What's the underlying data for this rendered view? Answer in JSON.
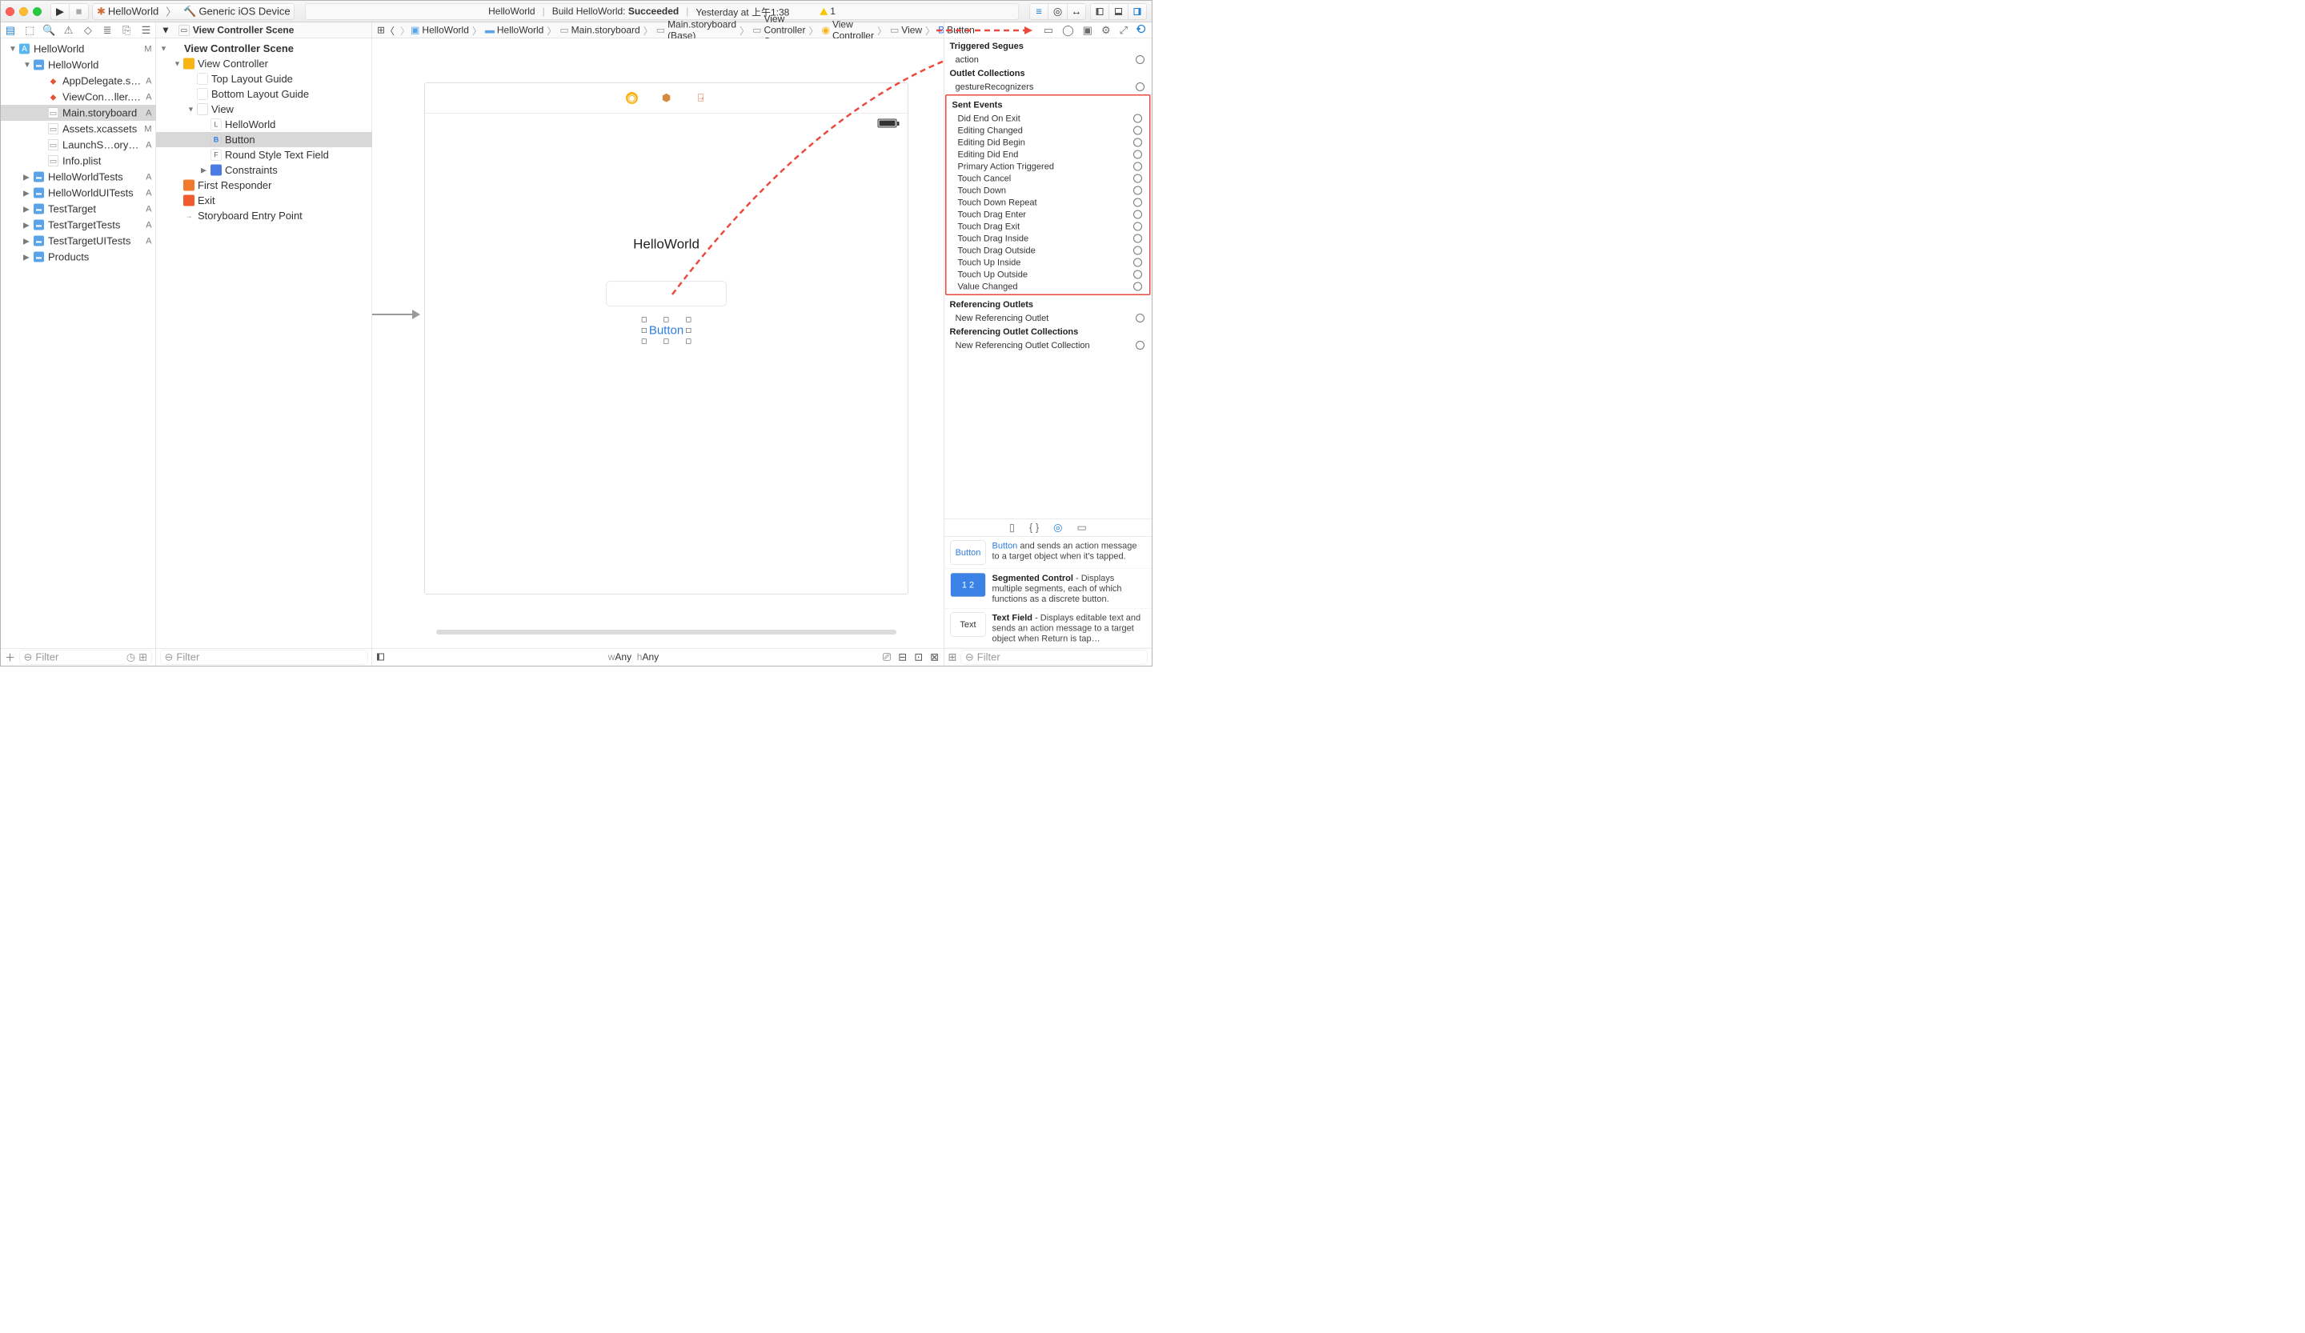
{
  "toolbar": {
    "scheme_app": "HelloWorld",
    "scheme_dest": "Generic iOS Device",
    "activity_prefix": "HelloWorld",
    "activity_mid": "Build HelloWorld:",
    "activity_status": "Succeeded",
    "activity_time": "Yesterday at 上午1:38",
    "warn_count": "1"
  },
  "nav": {
    "filter_placeholder": "Filter",
    "items": [
      {
        "ind": 0,
        "icon": "appicon",
        "disc": "▼",
        "name": "HelloWorld",
        "badge": "M"
      },
      {
        "ind": 1,
        "icon": "folder",
        "disc": "▼",
        "name": "HelloWorld",
        "badge": ""
      },
      {
        "ind": 2,
        "icon": "swift",
        "disc": "",
        "name": "AppDelegate.swift",
        "badge": "A"
      },
      {
        "ind": 2,
        "icon": "swift",
        "disc": "",
        "name": "ViewCon…ller.swift",
        "badge": "A"
      },
      {
        "ind": 2,
        "icon": "sb",
        "disc": "",
        "name": "Main.storyboard",
        "badge": "A",
        "sel": true
      },
      {
        "ind": 2,
        "icon": "sb",
        "disc": "",
        "name": "Assets.xcassets",
        "badge": "M"
      },
      {
        "ind": 2,
        "icon": "sb",
        "disc": "",
        "name": "LaunchS…oryboard",
        "badge": "A"
      },
      {
        "ind": 2,
        "icon": "sb",
        "disc": "",
        "name": "Info.plist",
        "badge": ""
      },
      {
        "ind": 1,
        "icon": "folder",
        "disc": "▶",
        "name": "HelloWorldTests",
        "badge": "A"
      },
      {
        "ind": 1,
        "icon": "folder",
        "disc": "▶",
        "name": "HelloWorldUITests",
        "badge": "A"
      },
      {
        "ind": 1,
        "icon": "folder",
        "disc": "▶",
        "name": "TestTarget",
        "badge": "A"
      },
      {
        "ind": 1,
        "icon": "folder",
        "disc": "▶",
        "name": "TestTargetTests",
        "badge": "A"
      },
      {
        "ind": 1,
        "icon": "folder",
        "disc": "▶",
        "name": "TestTargetUITests",
        "badge": "A"
      },
      {
        "ind": 1,
        "icon": "folder",
        "disc": "▶",
        "name": "Products",
        "badge": ""
      }
    ]
  },
  "outline": {
    "title": "View Controller Scene",
    "filter_placeholder": "Filter",
    "items": [
      {
        "ind": 0,
        "disc": "▼",
        "icon": "",
        "name": "View Controller Scene",
        "bold": true
      },
      {
        "ind": 1,
        "disc": "▼",
        "icon": "vcicon",
        "name": "View Controller"
      },
      {
        "ind": 2,
        "disc": "",
        "icon": "guideicon",
        "name": "Top Layout Guide"
      },
      {
        "ind": 2,
        "disc": "",
        "icon": "guideicon",
        "name": "Bottom Layout Guide"
      },
      {
        "ind": 2,
        "disc": "▼",
        "icon": "viewicon",
        "name": "View"
      },
      {
        "ind": 3,
        "disc": "",
        "icon": "licon",
        "glyph": "L",
        "name": "HelloWorld"
      },
      {
        "ind": 3,
        "disc": "",
        "icon": "bicon",
        "glyph": "B",
        "name": "Button",
        "sel": true
      },
      {
        "ind": 3,
        "disc": "",
        "icon": "licon",
        "glyph": "F",
        "name": "Round Style Text Field"
      },
      {
        "ind": 3,
        "disc": "▶",
        "icon": "cicon",
        "name": "Constraints"
      },
      {
        "ind": 1,
        "disc": "",
        "icon": "fricon",
        "name": "First Responder"
      },
      {
        "ind": 1,
        "disc": "",
        "icon": "exiticon",
        "name": "Exit"
      },
      {
        "ind": 1,
        "disc": "",
        "icon": "arrowicon",
        "glyph": "→",
        "name": "Storyboard Entry Point"
      }
    ]
  },
  "jumpbar": {
    "crumbs": [
      "HelloWorld",
      "HelloWorld",
      "Main.storyboard",
      "Main.storyboard (Base)",
      "View Controller Scene",
      "View Controller",
      "View",
      "Button"
    ]
  },
  "canvas": {
    "hello_label": "HelloWorld",
    "button_label": "Button",
    "size_w": "Any",
    "size_h": "Any",
    "size_wlabel": "w",
    "size_hlabel": "h"
  },
  "inspector": {
    "sections": {
      "triggered": "Triggered Segues",
      "action": "action",
      "outletcol": "Outlet Collections",
      "gesture": "gestureRecognizers",
      "sent": "Sent Events",
      "refo": "Referencing Outlets",
      "newrefo": "New Referencing Outlet",
      "refoc": "Referencing Outlet Collections",
      "newrefoc": "New Referencing Outlet Collection"
    },
    "sent_events": [
      "Did End On Exit",
      "Editing Changed",
      "Editing Did Begin",
      "Editing Did End",
      "Primary Action Triggered",
      "Touch Cancel",
      "Touch Down",
      "Touch Down Repeat",
      "Touch Drag Enter",
      "Touch Drag Exit",
      "Touch Drag Inside",
      "Touch Drag Outside",
      "Touch Up Inside",
      "Touch Up Outside",
      "Value Changed"
    ],
    "library": [
      {
        "thumb": "Button",
        "title": "",
        "desc": "and sends an action message to a target object when it's tapped.",
        "link": true
      },
      {
        "thumb": "1 2",
        "title": "Segmented Control",
        "desc": " - Displays multiple segments, each of which functions as a discrete button."
      },
      {
        "thumb": "Text",
        "title": "Text Field",
        "desc": " - Displays editable text and sends an action message to a target object when Return is tap…"
      }
    ],
    "filter_placeholder": "Filter"
  }
}
